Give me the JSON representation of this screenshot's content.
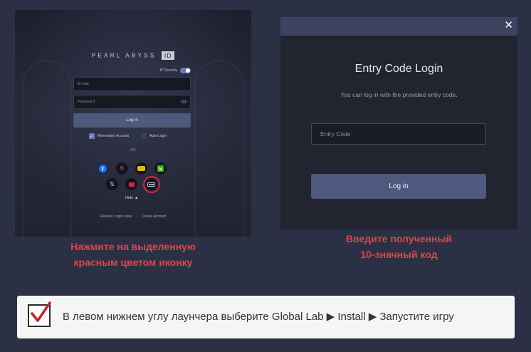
{
  "left_screen": {
    "logo": "PEARL ABYSS",
    "logo_badge": "ID",
    "ip_security_label": "IP Security",
    "email_placeholder": "E-mail",
    "password_placeholder": "Password",
    "login_label": "Log in",
    "remember_label": "Remember Account",
    "autologin_label": "Auto-Login",
    "or_label": "OR",
    "social_icons": [
      "facebook-icon",
      "google-icon",
      "yellow-service-icon",
      "naver-icon",
      "x-icon",
      "red-service-icon",
      "entry-code-icon"
    ],
    "hide_label": "Hide ▲",
    "resolve_label": "Resolve Login Issue",
    "create_label": "Create Account"
  },
  "right_screen": {
    "title": "Entry Code Login",
    "subtitle": "You can log in with the provided entry code.",
    "input_placeholder": "Entry Code",
    "login_label": "Log in",
    "close_glyph": "✕"
  },
  "captions": {
    "left_line1": "Нажмите на выделенную",
    "left_line2": "красным цветом иконку",
    "right_line1": "Введите полученный",
    "right_line2": "10-значный код"
  },
  "note": {
    "text": "В левом нижнем углу лаунчера выберите Global Lab ▶ Install ▶ Запустите игру"
  },
  "colors": {
    "background": "#2b3045",
    "caption_red": "#e0434e",
    "highlight_ring": "#d9283a",
    "button": "#4f587e"
  }
}
